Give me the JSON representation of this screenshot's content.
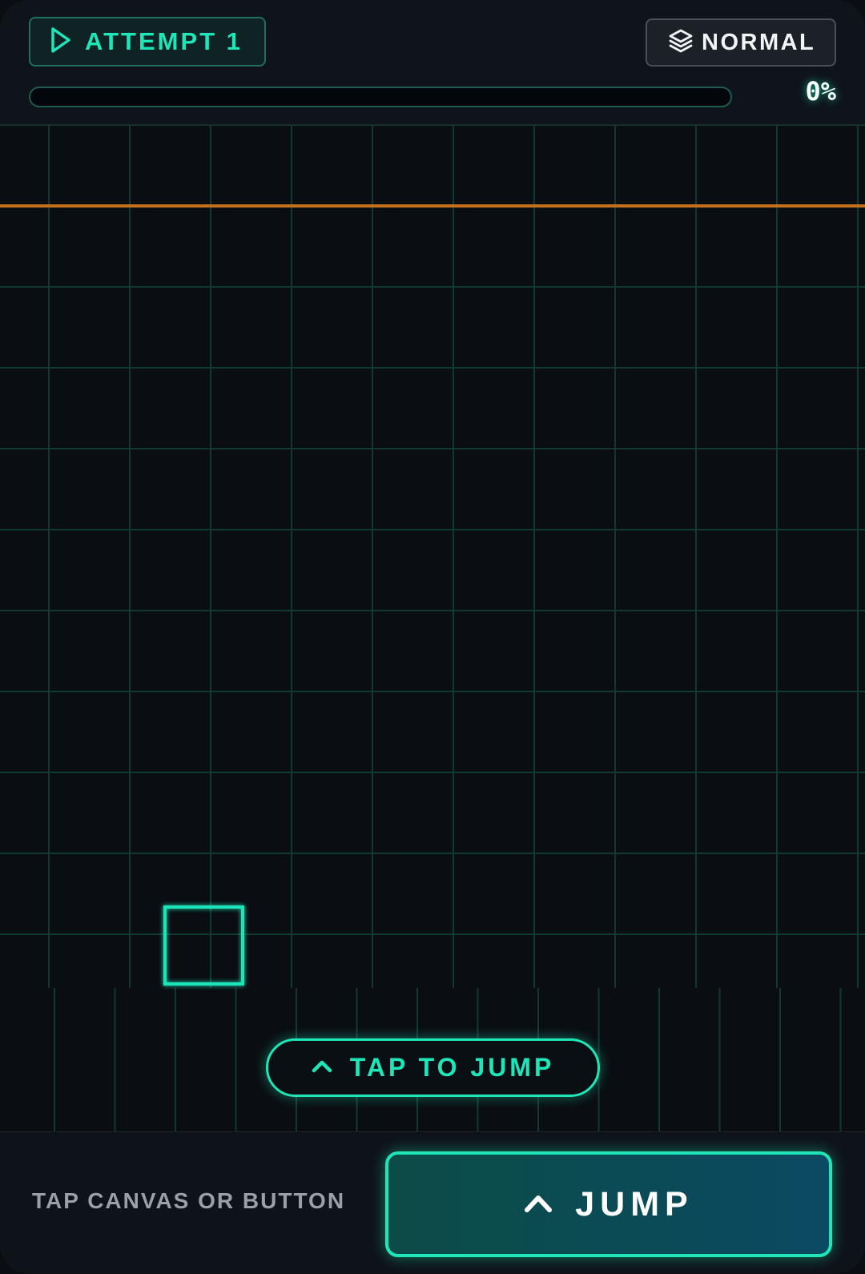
{
  "hud": {
    "attempt_label": "ATTEMPT 1",
    "attempt_icon": "play-icon",
    "difficulty_label": "NORMAL",
    "difficulty_icon": "layers-icon",
    "progress": 0,
    "progress_text": "0%"
  },
  "canvas": {
    "tap_hint": "TAP TO JUMP",
    "tap_hint_icon": "chevron-up-icon"
  },
  "controls": {
    "hint": "TAP CANVAS OR BUTTON",
    "jump_label": "JUMP",
    "jump_icon": "chevron-up-icon"
  },
  "colors": {
    "accent": "#1ee6b9",
    "background": "#0a0d12",
    "ceiling_line": "#c2701c",
    "grid": "#12392f",
    "text_muted": "#9aa0a8"
  }
}
